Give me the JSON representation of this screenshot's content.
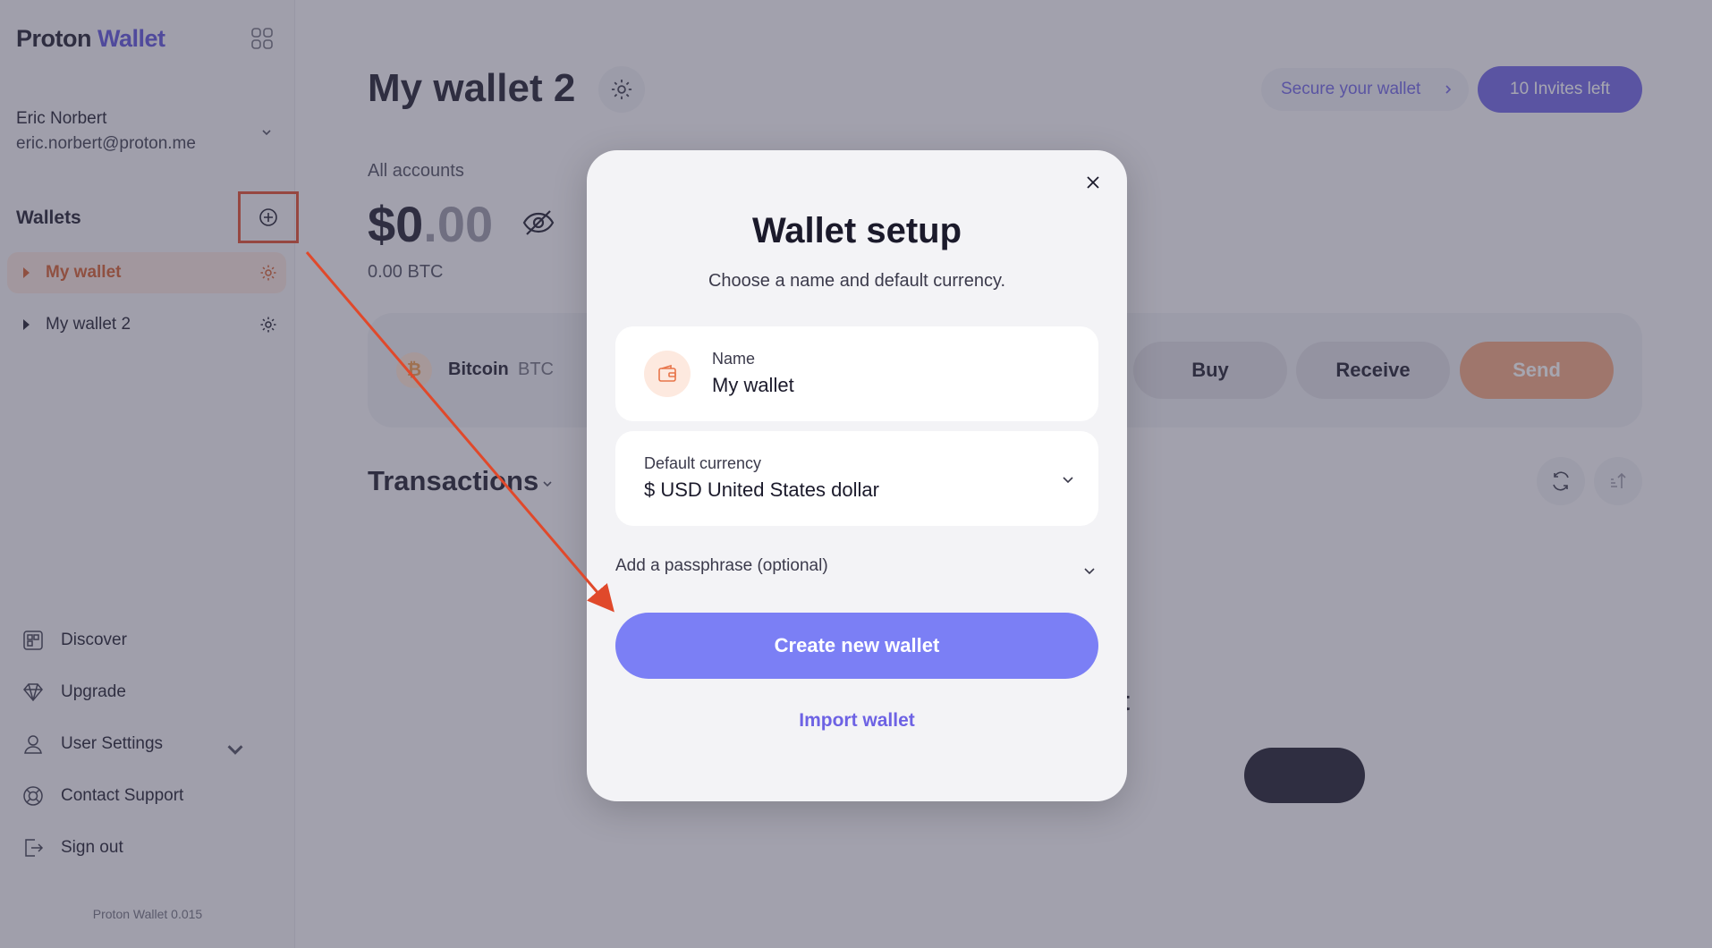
{
  "app": {
    "logo_primary": "Proton",
    "logo_accent": "Wallet",
    "version": "Proton Wallet 0.015"
  },
  "user": {
    "name": "Eric Norbert",
    "email": "eric.norbert@proton.me"
  },
  "sidebar": {
    "wallets_title": "Wallets",
    "wallets": [
      {
        "label": "My wallet",
        "active": true
      },
      {
        "label": "My wallet 2",
        "active": false
      }
    ],
    "nav": [
      {
        "label": "Discover",
        "icon": "discover-icon"
      },
      {
        "label": "Upgrade",
        "icon": "diamond-icon"
      },
      {
        "label": "User Settings",
        "icon": "user-icon"
      },
      {
        "label": "Contact Support",
        "icon": "lifebuoy-icon"
      },
      {
        "label": "Sign out",
        "icon": "sign-out-icon"
      }
    ]
  },
  "header": {
    "title": "My wallet 2",
    "secure_label": "Secure your wallet",
    "invites_label": "10 Invites left"
  },
  "balance": {
    "label": "All accounts",
    "whole": "$0",
    "cents": ".00",
    "btc": "0.00 BTC"
  },
  "account": {
    "coin_symbol": "₿",
    "coin_name": "Bitcoin",
    "ticker": "BTC",
    "buy_label": "Buy",
    "receive_label": "Receive",
    "send_label": "Send"
  },
  "transactions": {
    "title": "Transactions",
    "background_text": "allet"
  },
  "modal": {
    "title": "Wallet setup",
    "subtitle": "Choose a name and default currency.",
    "name_label": "Name",
    "name_value": "My wallet",
    "currency_label": "Default currency",
    "currency_value": "$ USD United States dollar",
    "passphrase_label": "Add a passphrase (optional)",
    "create_label": "Create new wallet",
    "import_label": "Import wallet"
  },
  "colors": {
    "accent": "#6d62e4",
    "primary_button": "#7b7ff5",
    "wallet_active": "#d45b2b",
    "annotation": "#e0492b",
    "send": "#f2a37d"
  }
}
